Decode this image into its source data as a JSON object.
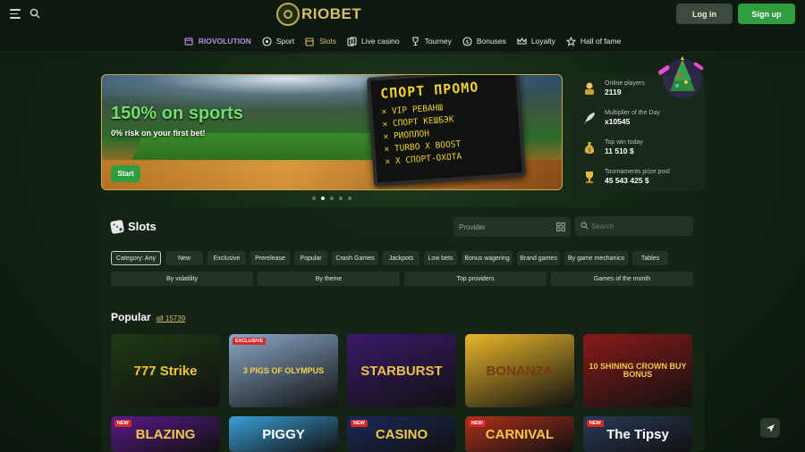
{
  "header": {
    "logo_text": "RIOBET",
    "login_label": "Log in",
    "signup_label": "Sign up"
  },
  "nav": {
    "items": [
      {
        "label": "RIOVOLUTION",
        "icon": "calendar-icon"
      },
      {
        "label": "Sport",
        "icon": "soccer-ball-icon"
      },
      {
        "label": "Slots",
        "icon": "slot-machine-icon"
      },
      {
        "label": "Live casino",
        "icon": "cards-icon"
      },
      {
        "label": "Tourney",
        "icon": "trophy-icon"
      },
      {
        "label": "Bonuses",
        "icon": "coin-icon"
      },
      {
        "label": "Loyalty",
        "icon": "crown-icon"
      },
      {
        "label": "Hall of fame",
        "icon": "star-icon"
      }
    ]
  },
  "banner": {
    "title": "150% on sports",
    "subtitle": "0% risk on your first bet!",
    "button_label": "Start",
    "board_title": "СПОРТ ПРОМО",
    "board_lines": [
      "✕ VIP РЕВАНШ",
      "✕ СПОРТ КЕШБЭК",
      "✕ РИОПЛОН",
      "✕ TURBO X BOOST",
      "✕ Х СПОРТ-ОХОТА"
    ],
    "slides_count": 5,
    "active_slide": 2
  },
  "stats": [
    {
      "label": "Online players",
      "value": "2119",
      "icon": "player-icon"
    },
    {
      "label": "Multiplier of the Day",
      "value": "x10545",
      "icon": "rocket-icon"
    },
    {
      "label": "Top win today",
      "value": "11 510 $",
      "icon": "money-bag-icon"
    },
    {
      "label": "Tournaments prize pool",
      "value": "45 543 425 $",
      "icon": "trophy-icon"
    }
  ],
  "slots": {
    "title": "Slots",
    "provider_placeholder": "Provider",
    "search_placeholder": "Search",
    "chips": [
      "Category: Any",
      "New",
      "Exclusive",
      "Prerelease",
      "Popular",
      "Crash Games",
      "Jackpots",
      "Low bets",
      "Bonus wagering",
      "Brand games",
      "By game mechanics",
      "Tables"
    ],
    "chips2": [
      "By volatility",
      "By theme",
      "Top providers",
      "Games of the month"
    ]
  },
  "popular": {
    "title": "Popular",
    "all_label": "all 15739"
  },
  "games_row1": [
    {
      "title": "777 Strike",
      "bg": "#1f3a14",
      "fg": "#f0c53a",
      "badge": ""
    },
    {
      "title": "3 PIGS OF OLYMPUS",
      "bg": "#8aa8c8",
      "fg": "#f4d24a",
      "badge": "EXCLUSIVE"
    },
    {
      "title": "STARBURST",
      "bg": "#3a1a6a",
      "fg": "#e8c04a",
      "badge": ""
    },
    {
      "title": "BONANZA",
      "bg": "#e9b62a",
      "fg": "#7a3a10",
      "badge": ""
    },
    {
      "title": "10 SHINING CROWN BUY BONUS",
      "bg": "#8a1a1a",
      "fg": "#f2c84a",
      "badge": ""
    }
  ],
  "games_row2": [
    {
      "title": "BLAZING",
      "bg": "#5a1a8a",
      "fg": "#f2c84a",
      "badge": "NEW"
    },
    {
      "title": "PIGGY",
      "bg": "#3aa0d8",
      "fg": "#ffffff",
      "badge": ""
    },
    {
      "title": "CASINO",
      "bg": "#1a2a5a",
      "fg": "#f2c84a",
      "badge": "NEW"
    },
    {
      "title": "CARNIVAL",
      "bg": "#b0301a",
      "fg": "#f2c84a",
      "badge": "NEW"
    },
    {
      "title": "The Tipsy",
      "bg": "#2a3a5a",
      "fg": "#ffffff",
      "badge": "NEW"
    }
  ]
}
